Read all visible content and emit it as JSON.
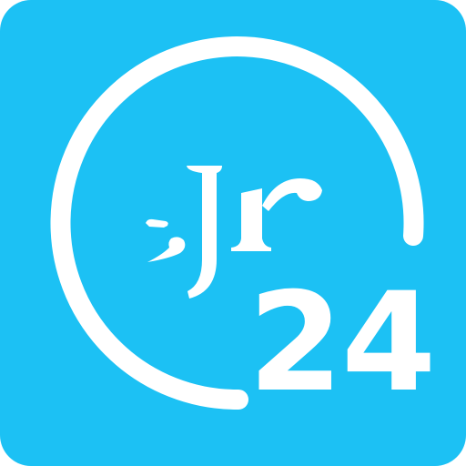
{
  "logo": {
    "monogram": "Jr",
    "number": "24"
  },
  "colors": {
    "background": "#1CC1F4",
    "foreground": "#FFFFFF",
    "outer_margin": "#FFFFFF"
  }
}
